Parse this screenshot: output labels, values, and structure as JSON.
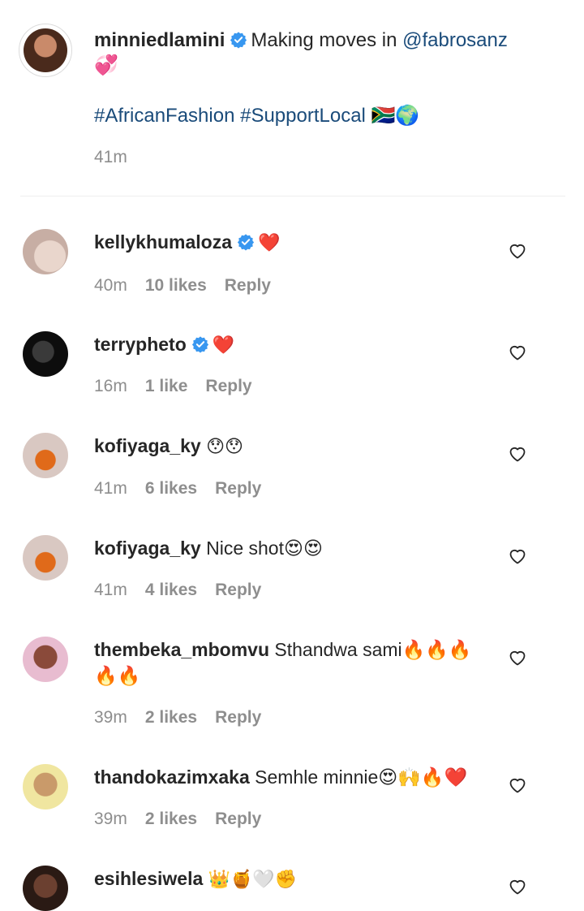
{
  "caption": {
    "username": "minniedlamini",
    "text_prefix": "Making moves in ",
    "mention": "@fabrosanz",
    "emoji_line": "💞",
    "tags": "#AfricanFashion #SupportLocal 🇿🇦🌍",
    "time": "41m"
  },
  "comments": [
    {
      "username": "kellykhumaloza",
      "verified": true,
      "text": "❤️",
      "time": "40m",
      "likes": "10 likes",
      "reply": "Reply"
    },
    {
      "username": "terrypheto",
      "verified": true,
      "text": "❤️",
      "time": "16m",
      "likes": "1 like",
      "reply": "Reply"
    },
    {
      "username": "kofiyaga_ky",
      "verified": false,
      "text": "😯😯",
      "time": "41m",
      "likes": "6 likes",
      "reply": "Reply"
    },
    {
      "username": "kofiyaga_ky",
      "verified": false,
      "text": "Nice shot😍😍",
      "time": "41m",
      "likes": "4 likes",
      "reply": "Reply"
    },
    {
      "username": "thembeka_mbomvu",
      "verified": false,
      "text": "Sthandwa sami🔥🔥🔥🔥🔥",
      "time": "39m",
      "likes": "2 likes",
      "reply": "Reply"
    },
    {
      "username": "thandokazimxaka",
      "verified": false,
      "text": "Semhle minnie😍🙌🔥❤️",
      "time": "39m",
      "likes": "2 likes",
      "reply": "Reply"
    },
    {
      "username": "esihlesiwela",
      "verified": false,
      "text": "👑🍯🤍✊",
      "time": "",
      "likes": "",
      "reply": ""
    }
  ],
  "colors": {
    "link": "#1a4b7a",
    "verified": "#3897f0",
    "muted": "#8e8e8e",
    "heart": "#e0245e"
  },
  "icons": {
    "like": "heart-outline-icon",
    "verified": "verified-badge-icon"
  }
}
